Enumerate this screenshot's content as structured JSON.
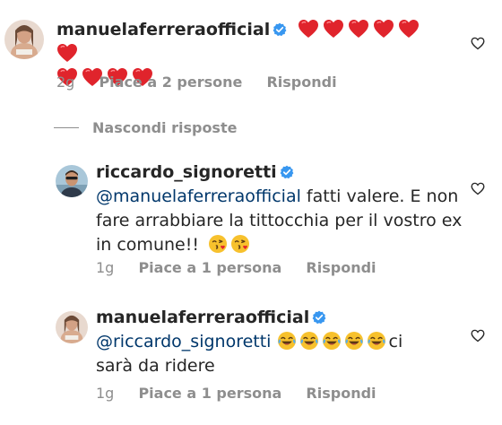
{
  "comments": [
    {
      "username": "manuelaferreraofficial",
      "emoji_text": "❤️❤️❤️❤️❤️❤️❤️❤️❤️❤️",
      "time": "2g",
      "likes": "Piace a 2 persone",
      "reply": "Rispondi"
    },
    {
      "username": "riccardo_signoretti",
      "mention": "@manuelaferreraofficial",
      "text_line1": " fatti valere. E non",
      "text_line2": "fare arrabbiare la tittocchia per il vostro ex",
      "text_line3": "in comune!!",
      "emoji_text": "😘😘",
      "time": "1g",
      "likes": "Piace a 1 persona",
      "reply": "Rispondi"
    },
    {
      "username": "manuelaferreraofficial",
      "mention": "@riccardo_signoretti",
      "emoji_text": "😂😂😂😂😂",
      "text_line1": "ci",
      "text_line2": "sarà da ridere",
      "time": "1g",
      "likes": "Piace a 1 persona",
      "reply": "Rispondi"
    }
  ],
  "hide_replies_label": "Nascondi risposte",
  "icons": {
    "verified": "verified-badge-icon",
    "like": "heart-outline-icon"
  },
  "colors": {
    "heart": "#e0242c",
    "verified": "#3897f0",
    "mention": "#00376b",
    "meta": "#8e8e8e"
  }
}
